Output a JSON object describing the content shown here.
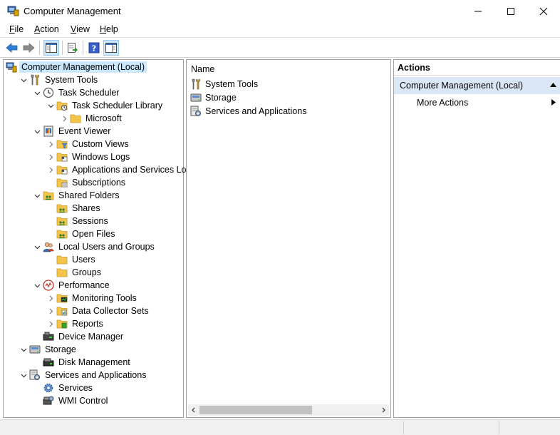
{
  "window": {
    "title": "Computer Management"
  },
  "menu": [
    {
      "key": "F",
      "rest": "ile"
    },
    {
      "key": "A",
      "rest": "ction"
    },
    {
      "key": "V",
      "rest": "iew"
    },
    {
      "key": "H",
      "rest": "elp"
    }
  ],
  "tree": [
    {
      "label": "Computer Management (Local)",
      "icon": "computer-management-icon",
      "selected": true
    },
    {
      "label": "System Tools",
      "icon": "system-tools-icon"
    },
    {
      "label": "Task Scheduler",
      "icon": "clock-icon"
    },
    {
      "label": "Task Scheduler Library",
      "icon": "folder-clock-icon"
    },
    {
      "label": "Microsoft",
      "icon": "folder-icon"
    },
    {
      "label": "Event Viewer",
      "icon": "event-viewer-icon"
    },
    {
      "label": "Custom Views",
      "icon": "folder-filter-icon"
    },
    {
      "label": "Windows Logs",
      "icon": "folder-logs-icon"
    },
    {
      "label": "Applications and Services Logs",
      "icon": "folder-logs-icon"
    },
    {
      "label": "Subscriptions",
      "icon": "folder-subscriptions-icon"
    },
    {
      "label": "Shared Folders",
      "icon": "shared-folder-icon"
    },
    {
      "label": "Shares",
      "icon": "shared-folder-icon"
    },
    {
      "label": "Sessions",
      "icon": "shared-folder-icon"
    },
    {
      "label": "Open Files",
      "icon": "shared-folder-icon"
    },
    {
      "label": "Local Users and Groups",
      "icon": "users-icon"
    },
    {
      "label": "Users",
      "icon": "folder-icon"
    },
    {
      "label": "Groups",
      "icon": "folder-icon"
    },
    {
      "label": "Performance",
      "icon": "performance-icon"
    },
    {
      "label": "Monitoring Tools",
      "icon": "folder-monitor-icon"
    },
    {
      "label": "Data Collector Sets",
      "icon": "folder-data-icon"
    },
    {
      "label": "Reports",
      "icon": "folder-reports-icon"
    },
    {
      "label": "Device Manager",
      "icon": "device-manager-icon"
    },
    {
      "label": "Storage",
      "icon": "storage-icon"
    },
    {
      "label": "Disk Management",
      "icon": "disk-management-icon"
    },
    {
      "label": "Services and Applications",
      "icon": "services-applications-icon"
    },
    {
      "label": "Services",
      "icon": "gear-icon"
    },
    {
      "label": "WMI Control",
      "icon": "wmi-control-icon"
    }
  ],
  "content": {
    "column_header": "Name",
    "items": [
      {
        "label": "System Tools",
        "icon": "system-tools-icon"
      },
      {
        "label": "Storage",
        "icon": "storage-icon"
      },
      {
        "label": "Services and Applications",
        "icon": "services-applications-icon"
      }
    ]
  },
  "actions": {
    "header": "Actions",
    "section": "Computer Management (Local)",
    "more": "More Actions"
  },
  "colors": {
    "selection": "#cce8ff",
    "actions_section": "#d9e7f6",
    "back_arrow": "#2d7fd3",
    "folder": "#f4c54a"
  }
}
